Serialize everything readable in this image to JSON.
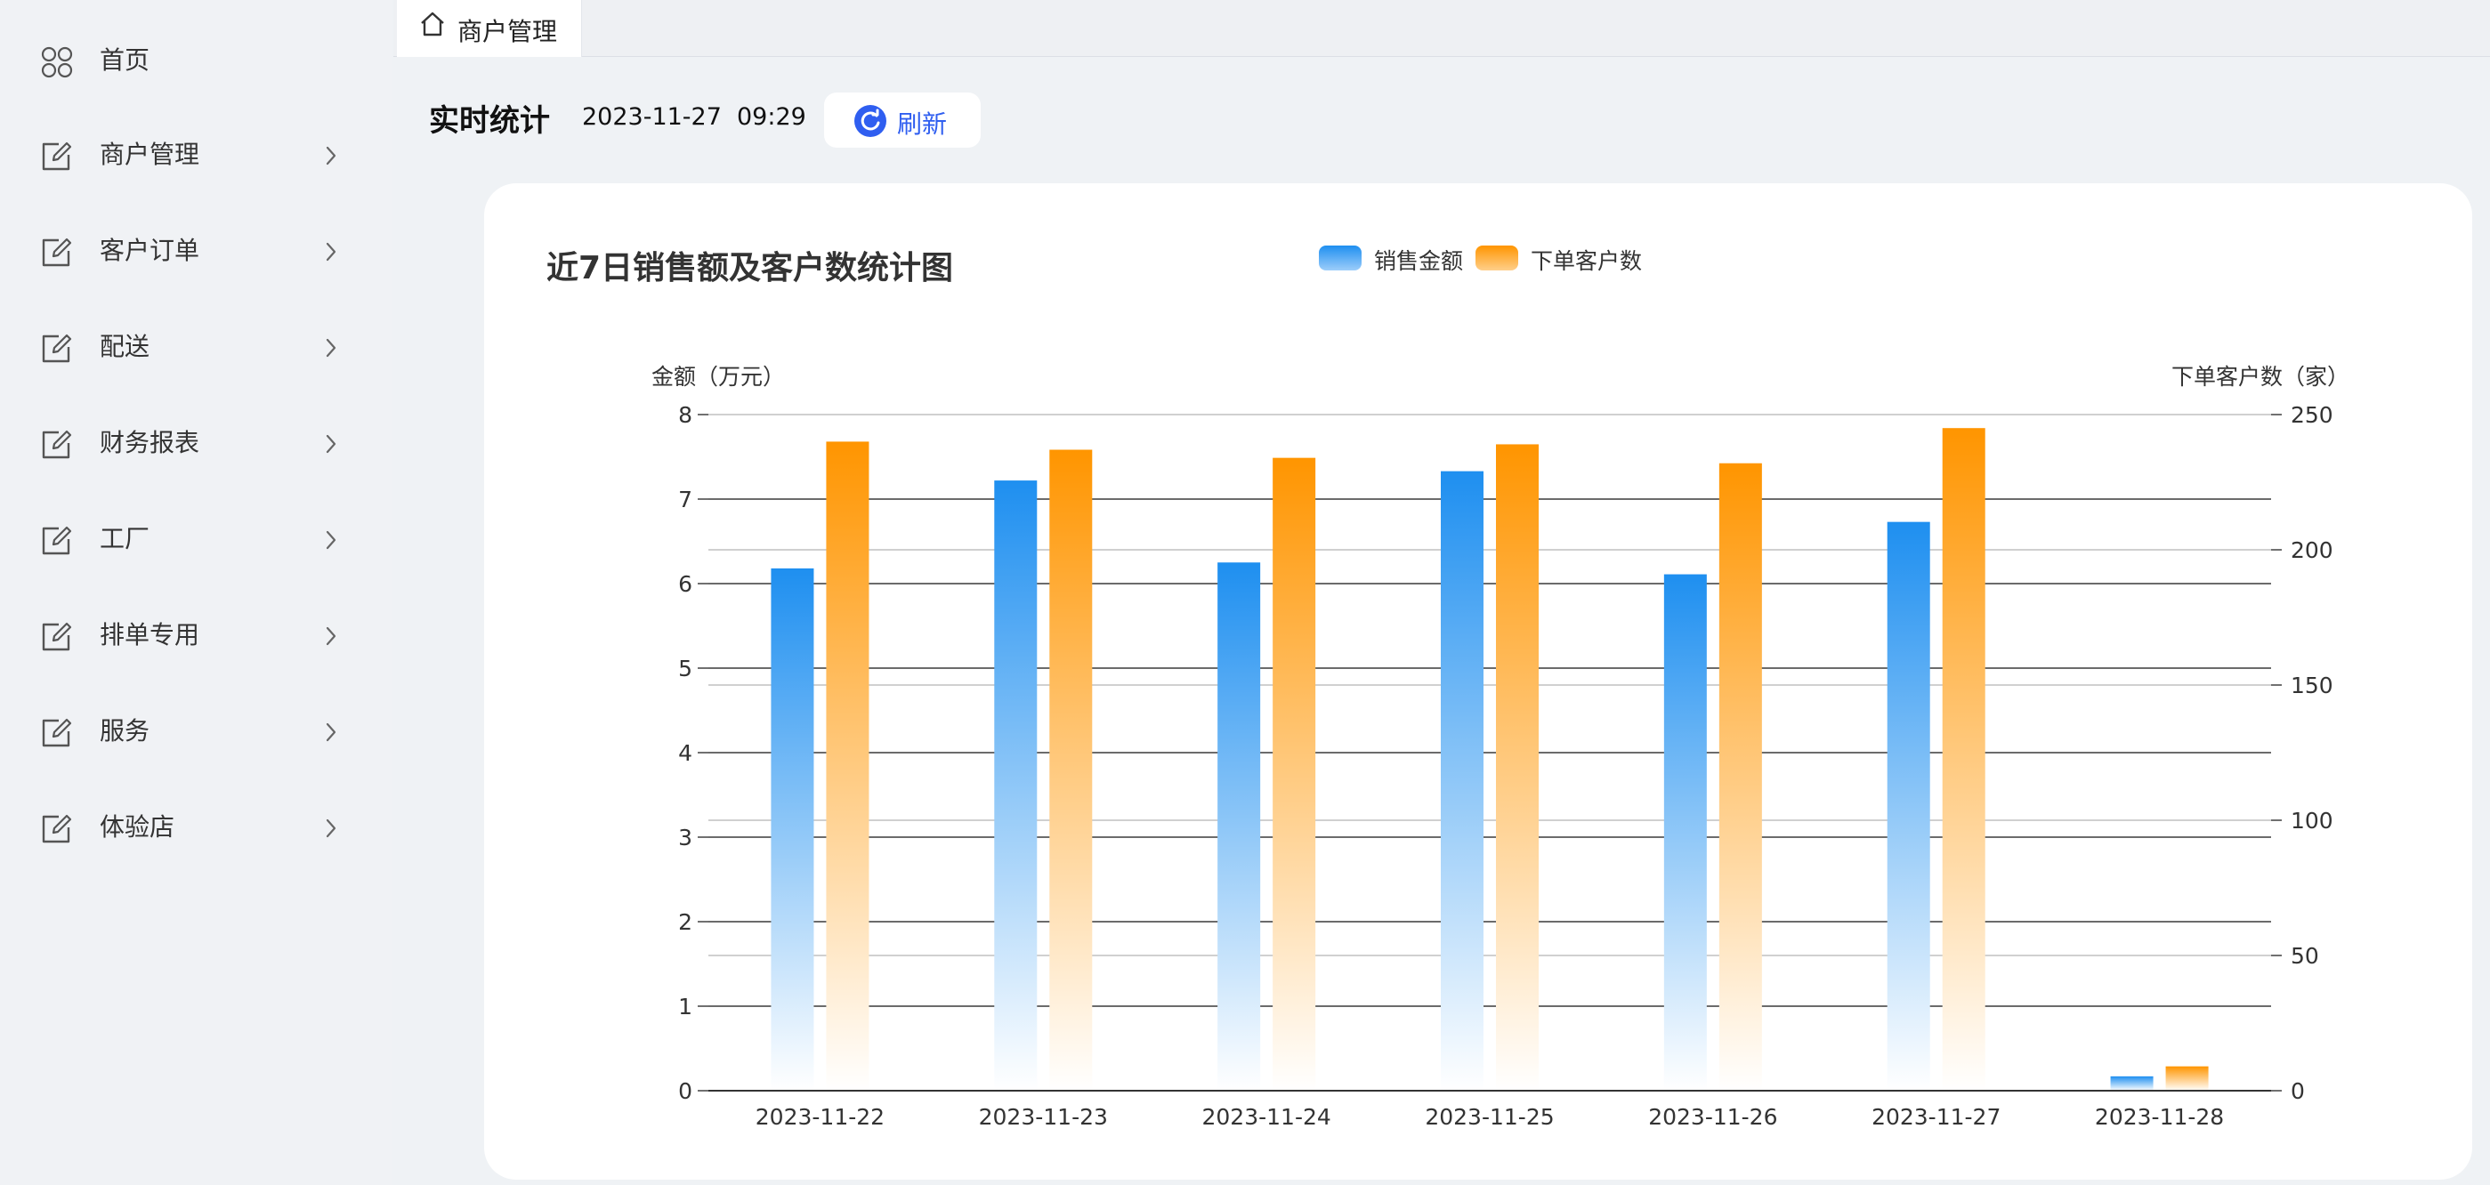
{
  "sidebar": {
    "items": [
      {
        "label": "首页",
        "icon": "grid-icon",
        "has_arrow": false
      },
      {
        "label": "商户管理",
        "icon": "edit-icon",
        "has_arrow": true
      },
      {
        "label": "客户订单",
        "icon": "edit-icon",
        "has_arrow": true
      },
      {
        "label": "配送",
        "icon": "edit-icon",
        "has_arrow": true
      },
      {
        "label": "财务报表",
        "icon": "edit-icon",
        "has_arrow": true
      },
      {
        "label": "工厂",
        "icon": "edit-icon",
        "has_arrow": true
      },
      {
        "label": "排单专用",
        "icon": "edit-icon",
        "has_arrow": true
      },
      {
        "label": "服务",
        "icon": "edit-icon",
        "has_arrow": true
      },
      {
        "label": "体验店",
        "icon": "edit-icon",
        "has_arrow": true
      }
    ]
  },
  "tabs": {
    "active": {
      "label": "商户管理",
      "icon": "home-icon"
    }
  },
  "header": {
    "title": "实时统计",
    "date": "2023-11-27",
    "time": "09:29",
    "refresh_label": "刷新"
  },
  "colors": {
    "accent": "#2f5ef0",
    "blue_series": "#1e8ff0",
    "orange_series": "#ff9500"
  },
  "chart_data": {
    "type": "bar",
    "title": "近7日销售额及客户数统计图",
    "categories": [
      "2023-11-22",
      "2023-11-23",
      "2023-11-24",
      "2023-11-25",
      "2023-11-26",
      "2023-11-27",
      "2023-11-28"
    ],
    "series": [
      {
        "name": "销售金额",
        "axis": "left",
        "color": "#1e8ff0",
        "values": [
          6.18,
          7.22,
          6.25,
          7.33,
          6.11,
          6.73,
          0.17
        ]
      },
      {
        "name": "下单客户数",
        "axis": "right",
        "color": "#ff9500",
        "values": [
          240,
          237,
          234,
          239,
          232,
          245,
          9
        ]
      }
    ],
    "y_left": {
      "label": "金额（万元）",
      "min": 0,
      "max": 8,
      "ticks": [
        0,
        1,
        2,
        3,
        4,
        5,
        6,
        7,
        8
      ]
    },
    "y_right": {
      "label": "下单客户数（家）",
      "min": 0,
      "max": 250,
      "ticks": [
        0,
        50,
        100,
        150,
        200,
        250
      ]
    },
    "grid": true,
    "legend": "top"
  }
}
